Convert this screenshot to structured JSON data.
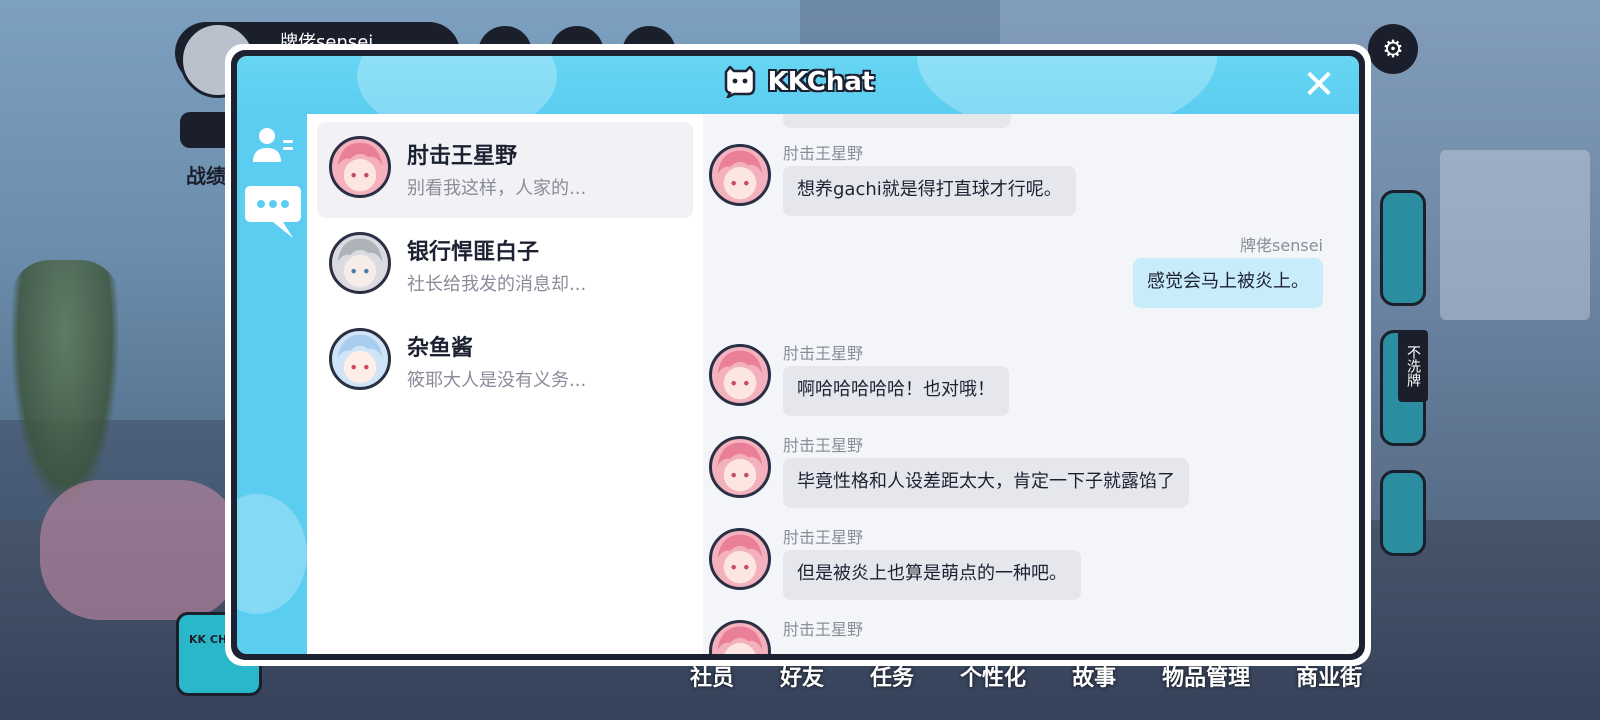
{
  "hud": {
    "player_name": "牌佬sensei",
    "record_label": "战绩",
    "kk_badge": "KK CHAT",
    "side_tag": "不洗牌",
    "nav": [
      "社员",
      "好友",
      "任务",
      "个性化",
      "故事",
      "物品管理",
      "商业街"
    ]
  },
  "modal": {
    "title": "KKChat",
    "close_label": "✕"
  },
  "conversations": [
    {
      "name": "肘击王星野",
      "preview": "别看我这样，人家的...",
      "active": true,
      "avatar": "pink-hair-avatar"
    },
    {
      "name": "银行悍匪白子",
      "preview": "社长给我发的消息却...",
      "active": false,
      "avatar": "silver-hair-avatar"
    },
    {
      "name": "杂鱼酱",
      "preview": "筱耶大人是没有义务...",
      "active": false,
      "avatar": "blue-hair-avatar"
    }
  ],
  "messages": [
    {
      "sender": "肘击王星野",
      "text": "想养gachi就是得打直球才行呢。",
      "mine": false
    },
    {
      "sender": "牌佬sensei",
      "text": "感觉会马上被炎上。",
      "mine": true
    },
    {
      "sender": "肘击王星野",
      "text": "啊哈哈哈哈哈！也对哦！",
      "mine": false
    },
    {
      "sender": "肘击王星野",
      "text": "毕竟性格和人设差距太大，肯定一下子就露馅了",
      "mine": false
    },
    {
      "sender": "肘击王星野",
      "text": "但是被炎上也算是萌点的一种吧。",
      "mine": false
    },
    {
      "sender": "肘击王星野",
      "text": "",
      "mine": false
    }
  ],
  "colors": {
    "accent": "#5bcdf0",
    "dark": "#1d2233",
    "my_bubble": "#c8ecfa",
    "their_bubble": "#e6e7ed"
  }
}
